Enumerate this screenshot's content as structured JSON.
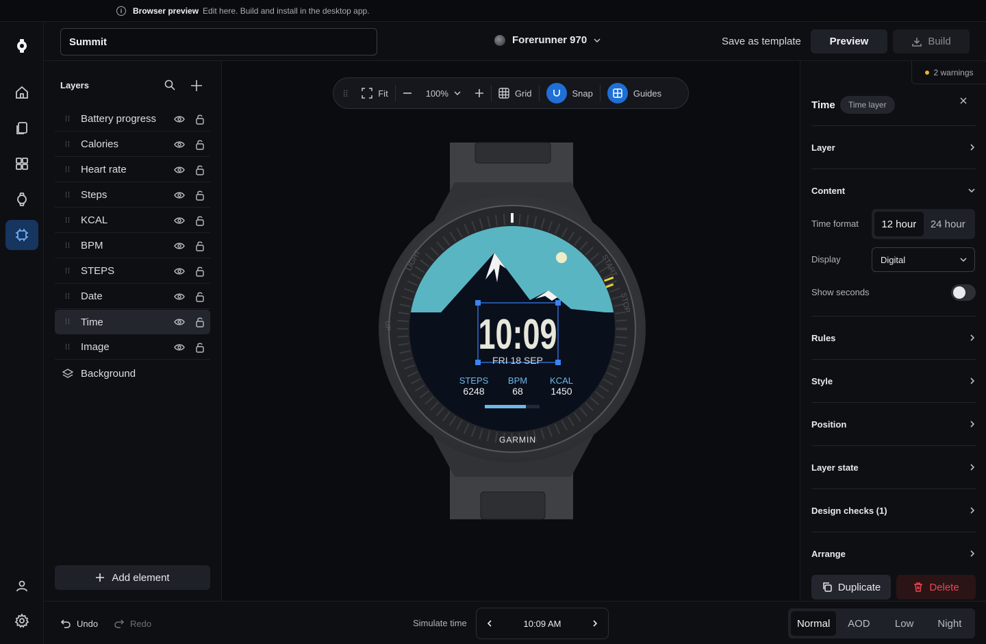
{
  "banner": {
    "title": "Browser preview",
    "message": "Edit here. Build and install in the desktop app."
  },
  "header": {
    "project_name": "Summit",
    "device": "Forerunner 970",
    "save_template": "Save as template",
    "preview": "Preview",
    "build": "Build"
  },
  "layers": {
    "title": "Layers",
    "items": [
      {
        "label": "Battery progress"
      },
      {
        "label": "Calories"
      },
      {
        "label": "Heart rate"
      },
      {
        "label": "Steps"
      },
      {
        "label": "KCAL"
      },
      {
        "label": "BPM"
      },
      {
        "label": "STEPS"
      },
      {
        "label": "Date"
      },
      {
        "label": "Time",
        "selected": true
      },
      {
        "label": "Image"
      }
    ],
    "background": "Background",
    "add_element": "Add element"
  },
  "canvas_toolbar": {
    "fit": "Fit",
    "zoom": "100%",
    "grid": "Grid",
    "snap": "Snap",
    "guides": "Guides"
  },
  "watch": {
    "time": "10:09",
    "date": "FRI 18 SEP",
    "stats": [
      {
        "label": "STEPS",
        "value": "6248"
      },
      {
        "label": "BPM",
        "value": "68"
      },
      {
        "label": "KCAL",
        "value": "1450"
      }
    ],
    "brand": "GARMIN",
    "bezel_labels": {
      "light": "LIGHT",
      "start": "START",
      "stop": "STOP",
      "up": "UP"
    },
    "battery_progress": 0.75,
    "colors": {
      "sky": "#5ab5c3",
      "mountain": "#0a0f1c",
      "stat_label": "#6fb8e6",
      "digits": "#e6e6da"
    }
  },
  "inspector": {
    "warnings": "2 warnings",
    "title": "Time",
    "badge": "Time layer",
    "sections": {
      "layer": "Layer",
      "content": "Content",
      "rules": "Rules",
      "style": "Style",
      "position": "Position",
      "layer_state": "Layer state",
      "design_checks": "Design checks (1)",
      "arrange": "Arrange"
    },
    "time_format_label": "Time format",
    "time_format_options": [
      "12 hour",
      "24 hour"
    ],
    "display_label": "Display",
    "display_value": "Digital",
    "show_seconds_label": "Show seconds",
    "duplicate": "Duplicate",
    "delete": "Delete"
  },
  "bottom": {
    "undo": "Undo",
    "redo": "Redo",
    "simulate_label": "Simulate time",
    "simulate_time": "10:09 AM",
    "modes": [
      "Normal",
      "AOD",
      "Low",
      "Night"
    ]
  }
}
